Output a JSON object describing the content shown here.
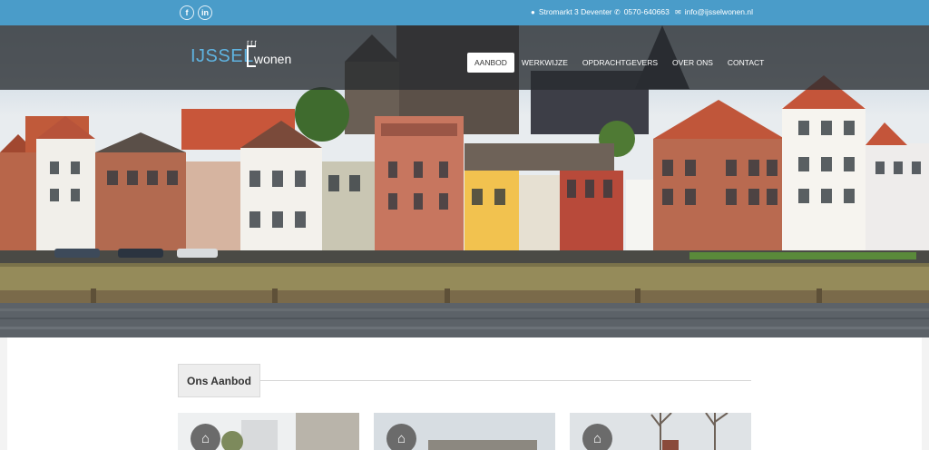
{
  "topbar": {
    "social": {
      "facebook": "f",
      "linkedin": "in"
    },
    "address": "Stromarkt 3 Deventer",
    "phone": "0570-640663",
    "email": "info@ijsselwonen.nl",
    "icons": {
      "address": "map-pin-icon",
      "phone": "phone-icon",
      "email": "envelope-icon"
    }
  },
  "logo": {
    "part1": "IJSSEL",
    "part2": "wonen"
  },
  "nav": {
    "items": [
      "AANBOD",
      "WERKWIJZE",
      "OPDRACHTGEVERS",
      "OVER ONS",
      "CONTACT"
    ],
    "active": "AANBOD"
  },
  "section": {
    "title": "Ons Aanbod"
  },
  "cards": {
    "icon": "home-icon",
    "count_visible": 3
  },
  "colors": {
    "topbar": "#4a9cc9",
    "logo_accent": "#5fb3e0",
    "navbar": "#2c3034"
  }
}
